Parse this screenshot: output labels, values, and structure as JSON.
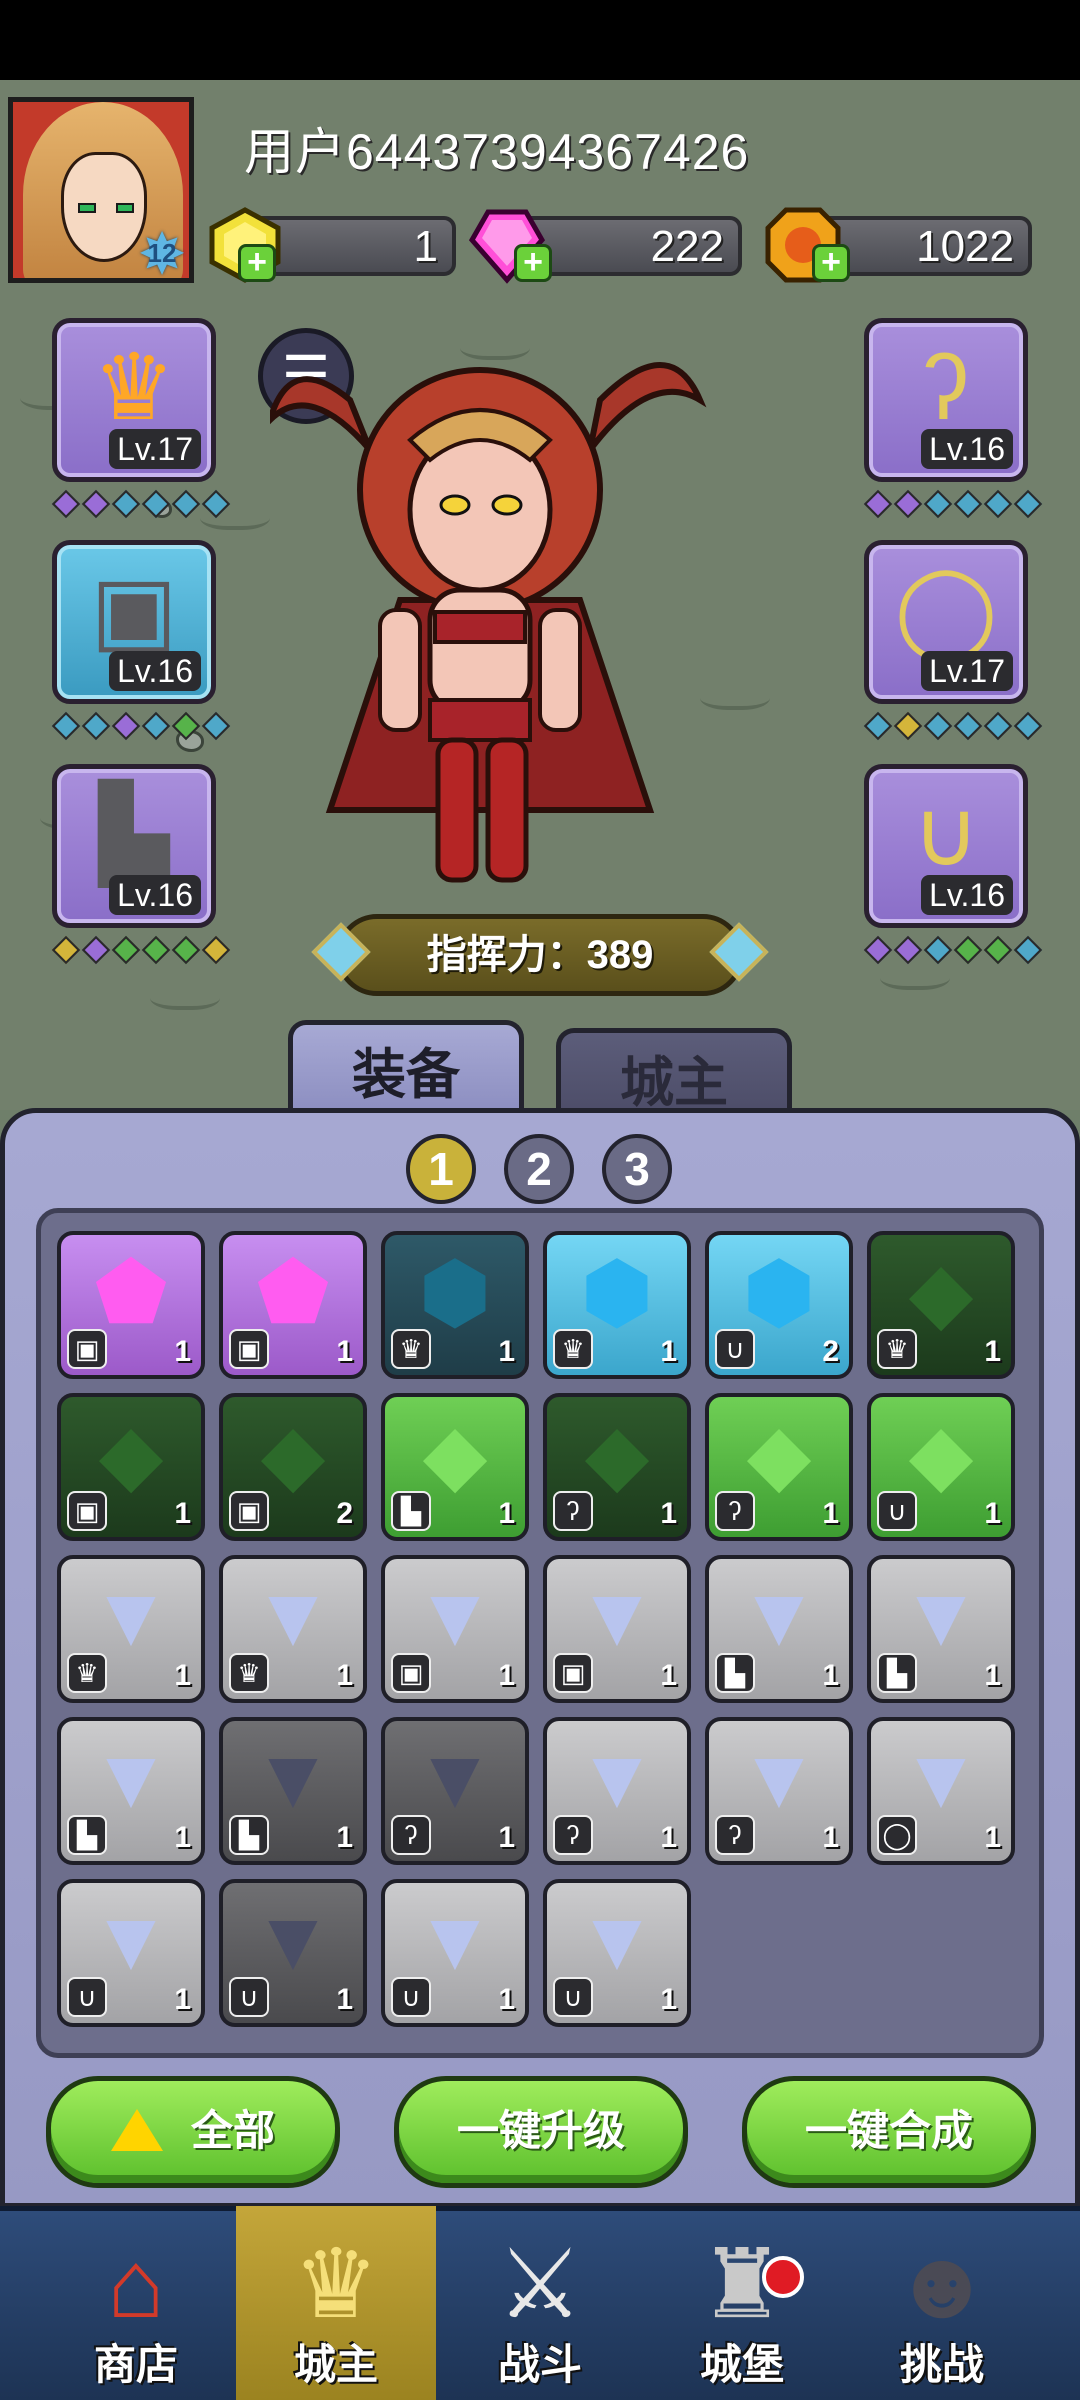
{
  "user": {
    "name": "用户64437394367426",
    "level": "12"
  },
  "currencies": [
    {
      "icon": "yellow-gem-icon",
      "value": "1",
      "color": "#f2e13a"
    },
    {
      "icon": "pink-gem-icon",
      "value": "222",
      "color": "#ff4fd8"
    },
    {
      "icon": "gold-coin-icon",
      "value": "1022",
      "color": "#f0a21a"
    }
  ],
  "equipment": {
    "left": [
      {
        "icon": "crown-icon",
        "level": "Lv.17",
        "gems": [
          "#9a6dd7",
          "#9a6dd7",
          "#4fa8c9",
          "#4fa8c9",
          "#4fa8c9",
          "#4fa8c9"
        ]
      },
      {
        "icon": "armor-icon",
        "level": "Lv.16",
        "gems": [
          "#4fa8c9",
          "#4fa8c9",
          "#9a6dd7",
          "#4fa8c9",
          "#57b34a",
          "#4fa8c9"
        ]
      },
      {
        "icon": "boot-icon",
        "level": "Lv.16",
        "gems": [
          "#d4b53a",
          "#9a6dd7",
          "#57b34a",
          "#57b34a",
          "#57b34a",
          "#d4b53a"
        ]
      }
    ],
    "right": [
      {
        "icon": "staff-icon",
        "level": "Lv.16",
        "gems": [
          "#9a6dd7",
          "#9a6dd7",
          "#4fa8c9",
          "#4fa8c9",
          "#4fa8c9",
          "#4fa8c9"
        ]
      },
      {
        "icon": "ring-icon",
        "level": "Lv.17",
        "gems": [
          "#4fa8c9",
          "#d4b53a",
          "#4fa8c9",
          "#4fa8c9",
          "#4fa8c9",
          "#4fa8c9"
        ]
      },
      {
        "icon": "necklace-icon",
        "level": "Lv.16",
        "gems": [
          "#9a6dd7",
          "#9a6dd7",
          "#4fa8c9",
          "#57b34a",
          "#57b34a",
          "#4fa8c9"
        ]
      }
    ]
  },
  "power": {
    "label": "指挥力：389"
  },
  "tabs": [
    {
      "label": "装备",
      "active": true
    },
    {
      "label": "城主",
      "active": false
    }
  ],
  "pages": [
    "1",
    "2",
    "3"
  ],
  "inventory": [
    {
      "style": "purple",
      "stone": "⬟",
      "type": "armor",
      "count": "1"
    },
    {
      "style": "purple",
      "stone": "⬟",
      "type": "armor",
      "count": "1"
    },
    {
      "style": "darkblue",
      "stone": "⬢",
      "type": "crown",
      "count": "1"
    },
    {
      "style": "blue",
      "stone": "⬢",
      "type": "crown",
      "count": "1"
    },
    {
      "style": "blue",
      "stone": "⬢",
      "type": "necklace",
      "count": "2"
    },
    {
      "style": "darkgreen",
      "stone": "◆",
      "type": "crown",
      "count": "1"
    },
    {
      "style": "darkgreen",
      "stone": "◆",
      "type": "armor",
      "count": "1"
    },
    {
      "style": "darkgreen",
      "stone": "◆",
      "type": "armor",
      "count": "2"
    },
    {
      "style": "green",
      "stone": "◆",
      "type": "boot",
      "count": "1"
    },
    {
      "style": "darkgreen",
      "stone": "◆",
      "type": "staff",
      "count": "1"
    },
    {
      "style": "green",
      "stone": "◆",
      "type": "staff",
      "count": "1"
    },
    {
      "style": "green",
      "stone": "◆",
      "type": "necklace",
      "count": "1"
    },
    {
      "style": "gray",
      "stone": "▼",
      "type": "crown",
      "count": "1"
    },
    {
      "style": "gray",
      "stone": "▼",
      "type": "crown",
      "count": "1"
    },
    {
      "style": "gray",
      "stone": "▼",
      "type": "armor",
      "count": "1"
    },
    {
      "style": "gray",
      "stone": "▼",
      "type": "armor",
      "count": "1"
    },
    {
      "style": "gray",
      "stone": "▼",
      "type": "boot",
      "count": "1"
    },
    {
      "style": "gray",
      "stone": "▼",
      "type": "boot",
      "count": "1"
    },
    {
      "style": "gray",
      "stone": "▼",
      "type": "boot",
      "count": "1"
    },
    {
      "style": "darkgray",
      "stone": "▼",
      "type": "boot",
      "count": "1"
    },
    {
      "style": "darkgray",
      "stone": "▼",
      "type": "staff",
      "count": "1"
    },
    {
      "style": "gray",
      "stone": "▼",
      "type": "staff",
      "count": "1"
    },
    {
      "style": "gray",
      "stone": "▼",
      "type": "staff",
      "count": "1"
    },
    {
      "style": "gray",
      "stone": "▼",
      "type": "ring",
      "count": "1"
    },
    {
      "style": "gray",
      "stone": "▼",
      "type": "necklace",
      "count": "1"
    },
    {
      "style": "darkgray",
      "stone": "▼",
      "type": "necklace",
      "count": "1"
    },
    {
      "style": "gray",
      "stone": "▼",
      "type": "necklace",
      "count": "1"
    },
    {
      "style": "gray",
      "stone": "▼",
      "type": "necklace",
      "count": "1"
    }
  ],
  "actions": {
    "all": "全部",
    "upgrade": "一键升级",
    "merge": "一键合成"
  },
  "nav": [
    {
      "label": "商店",
      "icon": "shop-icon",
      "active": false
    },
    {
      "label": "城主",
      "icon": "crown-icon",
      "active": true
    },
    {
      "label": "战斗",
      "icon": "swords-icon",
      "active": false
    },
    {
      "label": "城堡",
      "icon": "castle-icon",
      "active": false
    },
    {
      "label": "挑战",
      "icon": "demon-icon",
      "active": false
    }
  ]
}
